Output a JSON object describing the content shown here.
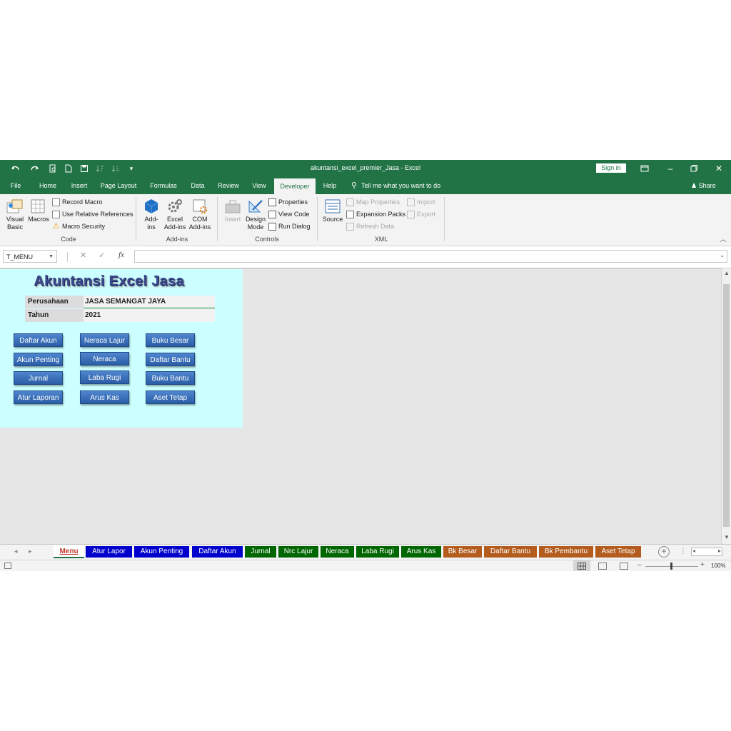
{
  "window": {
    "title": "akuntansi_excel_premier_Jasa  -  Excel",
    "sign_in_label": "Sign in"
  },
  "ribbon_tabs": [
    "File",
    "Home",
    "Insert",
    "Page Layout",
    "Formulas",
    "Data",
    "Review",
    "View",
    "Developer",
    "Help"
  ],
  "active_tab": "Developer",
  "tell_me": "Tell me what you want to do",
  "share": "Share",
  "ribbon": {
    "code": {
      "label": "Code",
      "visual_basic": [
        "Visual",
        "Basic"
      ],
      "macros": "Macros",
      "record_macro": "Record Macro",
      "relative_refs": "Use Relative References",
      "macro_security": "Macro Security"
    },
    "addins": {
      "label": "Add-ins",
      "addins": [
        "Add-",
        "ins"
      ],
      "excel_addins": [
        "Excel",
        "Add-ins"
      ],
      "com_addins": [
        "COM",
        "Add-ins"
      ]
    },
    "controls": {
      "label": "Controls",
      "insert": "Insert",
      "design_mode": [
        "Design",
        "Mode"
      ],
      "properties": "Properties",
      "view_code": "View Code",
      "run_dialog": "Run Dialog"
    },
    "xml": {
      "label": "XML",
      "source": "Source",
      "map_properties": "Map Properties",
      "expansion_packs": "Expansion Packs",
      "refresh_data": "Refresh Data",
      "import": "Import",
      "export": "Export"
    }
  },
  "formula_bar": {
    "name_box": "T_MENU",
    "fx": "fx",
    "value": ""
  },
  "menu_sheet": {
    "title": "Akuntansi Excel Jasa",
    "company_label": "Perusahaan",
    "company_value": "JASA SEMANGAT JAYA",
    "year_label": "Tahun",
    "year_value": "2021",
    "buttons": {
      "col1": [
        "Daftar Akun",
        "Akun Penting",
        "Jurnal",
        "Atur Laporan"
      ],
      "col2": [
        "Neraca Lajur",
        "Neraca",
        "Laba Rugi",
        "Arus Kas"
      ],
      "col3": [
        "Buku Besar",
        "Daftar Bantu",
        "Buku Bantu",
        "Aset Tetap"
      ]
    }
  },
  "sheet_tabs": [
    {
      "label": "Menu",
      "color": "#ffffff"
    },
    {
      "label": "Atur Lapor",
      "color": "#0000cc"
    },
    {
      "label": "Akun Penting",
      "color": "#0000cc"
    },
    {
      "label": "Daftar Akun",
      "color": "#0000cc"
    },
    {
      "label": "Jurnal",
      "color": "#006600"
    },
    {
      "label": "Nrc Lajur",
      "color": "#006600"
    },
    {
      "label": "Neraca",
      "color": "#006600"
    },
    {
      "label": "Laba Rugi",
      "color": "#006600"
    },
    {
      "label": "Arus Kas",
      "color": "#006600"
    },
    {
      "label": "Bk Besar",
      "color": "#b35c1e"
    },
    {
      "label": "Daftar Bantu",
      "color": "#b35c1e"
    },
    {
      "label": "Bk Pembantu",
      "color": "#b35c1e"
    },
    {
      "label": "Aset Tetap",
      "color": "#b35c1e"
    }
  ],
  "status": {
    "zoom": "100%"
  },
  "colors": {
    "excel_green": "#217346",
    "sheet_bg": "#ccffff",
    "button_blue": "#2f67b5"
  }
}
